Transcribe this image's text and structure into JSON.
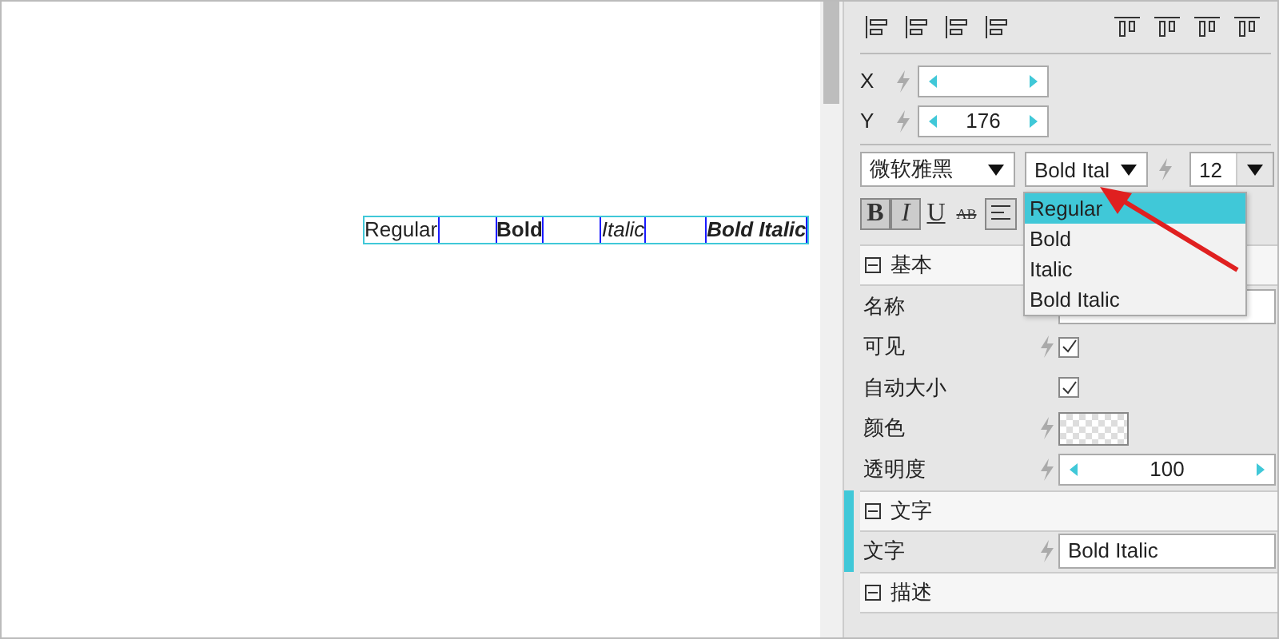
{
  "canvas": {
    "items": [
      {
        "text": "Regular",
        "kind": "regular"
      },
      {
        "text": "Bold",
        "kind": "bold"
      },
      {
        "text": "Italic",
        "kind": "italic"
      },
      {
        "text": "Bold Italic",
        "kind": "bolditalic"
      }
    ]
  },
  "panel": {
    "position": [
      {
        "label": "X"
      },
      {
        "label": "Y",
        "value": "176"
      }
    ],
    "font": {
      "family": "微软雅黑",
      "style": "Bold Ital",
      "size": "12"
    },
    "format_buttons": [
      {
        "label": "B",
        "selected": true
      },
      {
        "label": "I",
        "selected": true
      },
      {
        "label": "U",
        "selected": false
      },
      {
        "label": "AB",
        "selected": false
      }
    ],
    "style_dropdown": {
      "options": [
        {
          "label": "Regular",
          "selected": true
        },
        {
          "label": "Bold",
          "selected": false
        },
        {
          "label": "Italic",
          "selected": false
        },
        {
          "label": "Bold Italic",
          "selected": false
        }
      ]
    },
    "sections": [
      {
        "title": "基本",
        "highlighted": false,
        "rows": [
          {
            "kind": "text",
            "label": "名称",
            "binding": false
          },
          {
            "kind": "check",
            "label": "可见",
            "binding": true,
            "checked": true
          },
          {
            "kind": "check",
            "label": "自动大小",
            "binding": false,
            "checked": true
          },
          {
            "kind": "color",
            "label": "颜色",
            "binding": true
          },
          {
            "kind": "spinner",
            "label": "透明度",
            "binding": true,
            "value": "100"
          }
        ]
      },
      {
        "title": "文字",
        "highlighted": true,
        "rows": [
          {
            "kind": "text",
            "label": "文字",
            "binding": true,
            "value": "Bold Italic"
          }
        ]
      },
      {
        "title": "描述",
        "highlighted": false
      }
    ]
  }
}
